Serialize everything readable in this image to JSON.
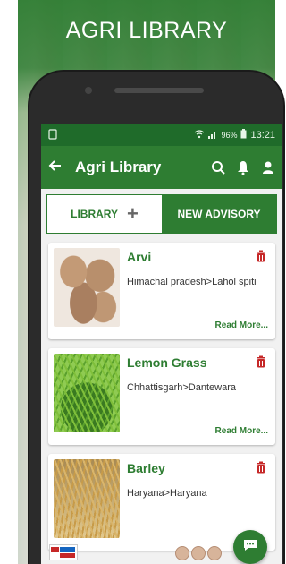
{
  "promo": {
    "title": "AGRI LIBRARY"
  },
  "statusbar": {
    "battery": "96%",
    "time": "13:21"
  },
  "appbar": {
    "title": "Agri Library"
  },
  "tabs": [
    {
      "label": "LIBRARY",
      "active": true
    },
    {
      "label": "NEW ADVISORY",
      "active": false
    }
  ],
  "cards": [
    {
      "name": "Arvi",
      "location": "Himachal pradesh>Lahol spiti",
      "read_more": "Read More..."
    },
    {
      "name": "Lemon Grass",
      "location": "Chhattisgarh>Dantewara",
      "read_more": "Read More..."
    },
    {
      "name": "Barley",
      "location": "Haryana>Haryana",
      "read_more": ""
    }
  ],
  "colors": {
    "primary": "#2e7d32",
    "statusbar": "#1f6b2a",
    "accent_delete": "#c62828"
  }
}
